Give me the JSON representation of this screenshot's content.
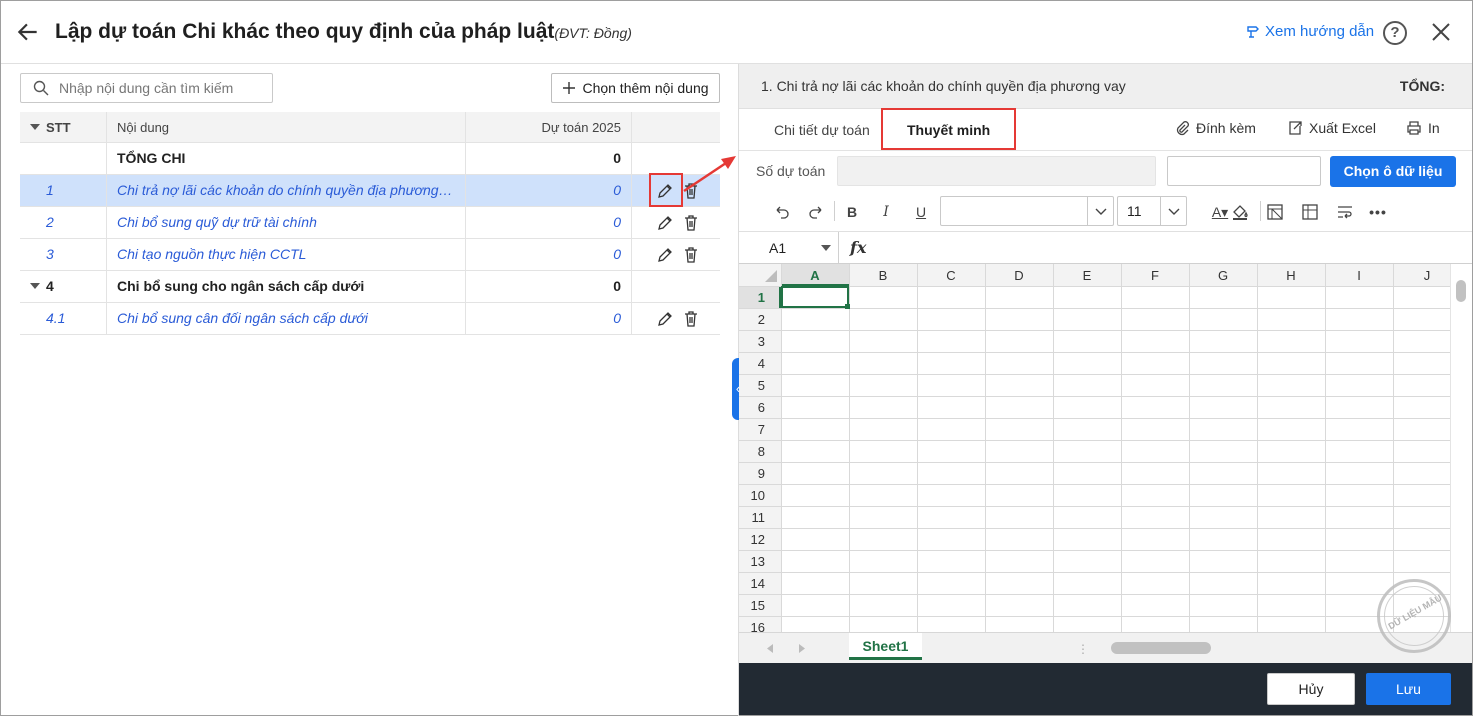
{
  "header": {
    "title": "Lập dự toán Chi khác theo quy định của pháp luật",
    "unit": "(ĐVT: Đồng)",
    "guide_label": "Xem hướng dẫn",
    "help_label": "?"
  },
  "left": {
    "search_placeholder": "Nhập nội dung cần tìm kiếm",
    "add_label": "Chọn thêm nội dung",
    "columns": {
      "stt": "STT",
      "noidung": "Nội dung",
      "dutoan": "Dự toán 2025"
    },
    "rows": [
      {
        "stt": "",
        "noidung": "TỔNG CHI",
        "dutoan": "0"
      },
      {
        "stt": "1",
        "noidung": "Chi trả nợ lãi các khoản do chính quyền địa phương…",
        "dutoan": "0"
      },
      {
        "stt": "2",
        "noidung": "Chi bổ sung quỹ dự trữ tài chính",
        "dutoan": "0"
      },
      {
        "stt": "3",
        "noidung": "Chi tạo nguồn thực hiện CCTL",
        "dutoan": "0"
      },
      {
        "stt": "4",
        "noidung": "Chi bổ sung cho ngân sách cấp dưới",
        "dutoan": "0"
      },
      {
        "stt": "4.1",
        "noidung": "Chi bổ sung cân đối ngân sách cấp dưới",
        "dutoan": "0"
      }
    ]
  },
  "right": {
    "item_title": "1. Chi trả nợ lãi các khoản do chính quyền địa phương vay",
    "total_label": "TỔNG:",
    "tabs": [
      "Chi tiết dự toán",
      "Thuyết minh"
    ],
    "actions": {
      "attach": "Đính kèm",
      "export": "Xuất Excel",
      "print": "In"
    },
    "so_du_toan_label": "Số dự toán",
    "choose_label": "Chọn ô dữ liệu",
    "font_size": "11",
    "namebox": "A1",
    "fx_label": "fx",
    "columns": [
      "A",
      "B",
      "C",
      "D",
      "E",
      "F",
      "G",
      "H",
      "I",
      "J"
    ],
    "rows": [
      "1",
      "2",
      "3",
      "4",
      "5",
      "6",
      "7",
      "8",
      "9",
      "10",
      "11",
      "12",
      "13",
      "14",
      "15",
      "16"
    ],
    "sheet_tab": "Sheet1",
    "cancel_label": "Hủy",
    "save_label": "Lưu",
    "stamp_text": "DỮ LIỆU MẪU"
  },
  "colors": {
    "accent": "#1a73e8",
    "link": "#2a5bd7",
    "selected_row": "#cfe1fb",
    "highlight": "#e53935",
    "footer": "#222a33",
    "sheet_green": "#217346"
  }
}
